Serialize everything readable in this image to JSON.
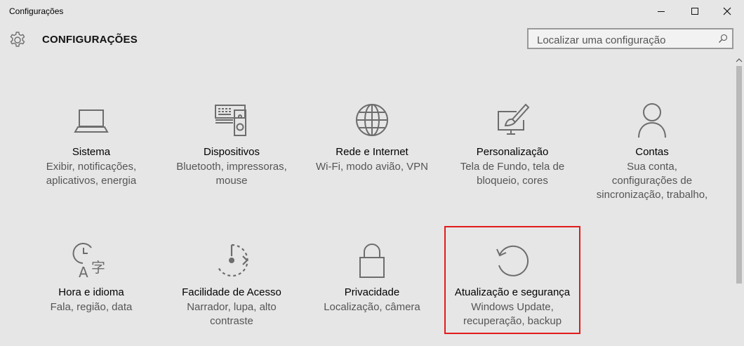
{
  "window": {
    "title": "Configurações"
  },
  "header": {
    "title": "CONFIGURAÇÕES",
    "search_placeholder": "Localizar uma configuração"
  },
  "tiles": [
    {
      "label": "Sistema",
      "desc_lines": [
        "Exibir, notificações,",
        "aplicativos, energia"
      ],
      "icon": "laptop-icon"
    },
    {
      "label": "Dispositivos",
      "desc_lines": [
        "Bluetooth, impressoras,",
        "mouse"
      ],
      "icon": "keyboard-speaker-icon"
    },
    {
      "label": "Rede e Internet",
      "desc_lines": [
        "Wi-Fi, modo avião, VPN"
      ],
      "icon": "globe-icon"
    },
    {
      "label": "Personalização",
      "desc_lines": [
        "Tela de Fundo, tela de",
        "bloqueio, cores"
      ],
      "icon": "paint-monitor-icon"
    },
    {
      "label": "Contas",
      "desc_lines": [
        "Sua conta,",
        "configurações de",
        "sincronização, trabalho,"
      ],
      "icon": "person-icon"
    },
    {
      "label": "Hora e idioma",
      "desc_lines": [
        "Fala, região, data"
      ],
      "icon": "time-language-icon"
    },
    {
      "label": "Facilidade de Acesso",
      "desc_lines": [
        "Narrador, lupa, alto",
        "contraste"
      ],
      "icon": "ease-of-access-icon"
    },
    {
      "label": "Privacidade",
      "desc_lines": [
        "Localização, câmera"
      ],
      "icon": "lock-icon"
    },
    {
      "label": "Atualização e segurança",
      "desc_lines": [
        "Windows Update,",
        "recuperação, backup"
      ],
      "icon": "update-icon"
    }
  ],
  "colors": {
    "background": "#e6e6e6",
    "icon": "#6d6d6d",
    "highlight": "#e21b1b"
  }
}
